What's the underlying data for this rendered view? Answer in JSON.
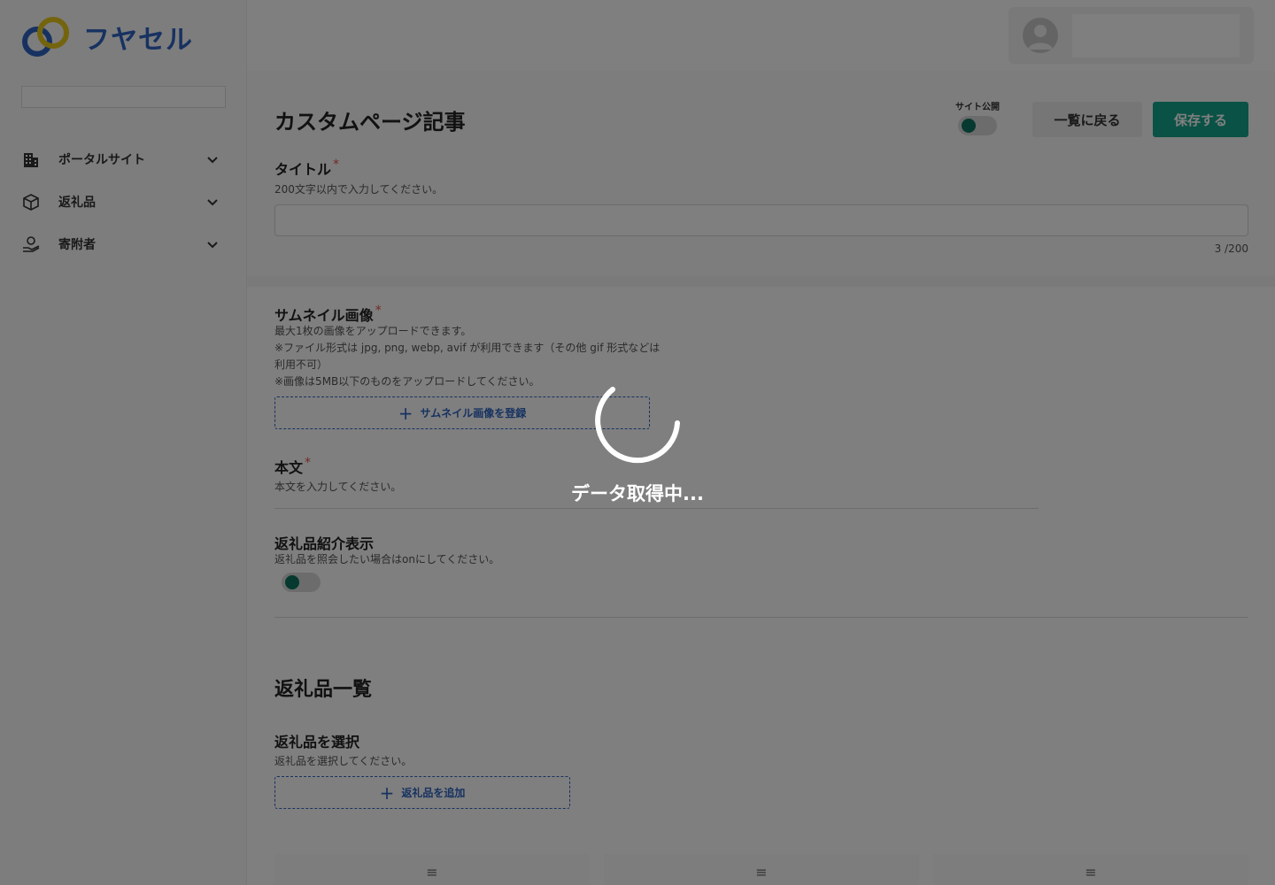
{
  "brand": {
    "name": "フヤセル"
  },
  "sidebar": {
    "items": [
      {
        "label": "ポータルサイト",
        "icon": "building-icon"
      },
      {
        "label": "返礼品",
        "icon": "box-icon"
      },
      {
        "label": "寄附者",
        "icon": "hand-heart-icon"
      }
    ]
  },
  "header": {
    "user_icon": "user-avatar-icon"
  },
  "page": {
    "title": "カスタムページ記事",
    "publish_label": "サイト公開",
    "back_button": "一覧に戻る",
    "save_button": "保存する"
  },
  "fields": {
    "title": {
      "label": "タイトル",
      "required": "*",
      "help": "200文字以内で入力してください。",
      "counter": "3 /200"
    },
    "thumbnail": {
      "label": "サムネイル画像",
      "required": "*",
      "help1": "最大1枚の画像をアップロードできます。",
      "help2": "※ファイル形式は jpg, png, webp, avif が利用できます（その他 gif 形式などは",
      "help3": "利用不可）",
      "help4": "※画像は5MB以下のものをアップロードしてください。",
      "button": "サムネイル画像を登録"
    },
    "body": {
      "label": "本文",
      "required": "*",
      "help": "本文を入力してください。"
    },
    "gift_display": {
      "label": "返礼品紹介表示",
      "help": "返礼品を照会したい場合はonにしてください。"
    }
  },
  "gift_list": {
    "title": "返礼品一覧",
    "select_label": "返礼品を選択",
    "select_help": "返礼品を選択してください。",
    "add_button": "返礼品を追加",
    "slot_icon": "≡"
  },
  "loading": {
    "text": "データ取得中..."
  },
  "colors": {
    "accent": "#14a58a",
    "brand_blue": "#2f64c3",
    "brand_yellow": "#e8c81c",
    "required": "#e4554b"
  }
}
